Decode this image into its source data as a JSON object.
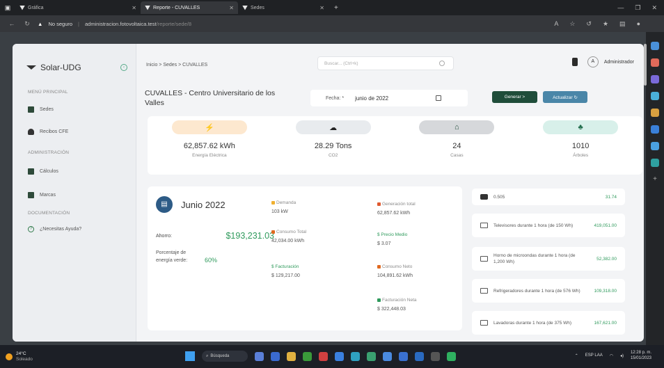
{
  "browser": {
    "tabs": [
      {
        "label": "Gráfica"
      },
      {
        "label": "Reporte - CUVALLES"
      },
      {
        "label": "Sedes"
      }
    ],
    "security": "No seguro",
    "url_host": "administracion.fotovoltaica.test",
    "url_path": "/reporte/sede/8"
  },
  "sidebar": {
    "brand": "Solar-UDG",
    "sections": [
      {
        "title": "MENÚ PRINCIPAL",
        "items": [
          "Sedes",
          "Recibos CFE"
        ]
      },
      {
        "title": "ADMINISTRACIÓN",
        "items": [
          "Cálculos",
          "Marcas"
        ]
      },
      {
        "title": "DOCUMENTACIÓN",
        "items": [
          "¿Necesitas Ayuda?"
        ]
      }
    ]
  },
  "topbar": {
    "breadcrumb": "Inicio  >  Sedes  >  CUVALLES",
    "search_placeholder": "Buscar... (Ctrl+k)",
    "avatar_letter": "A",
    "user_name": "Administrador"
  },
  "header": {
    "title": "CUVALLES - Centro Universitario de los Valles",
    "fecha_label": "Fecha: *",
    "fecha_value": "junio de 2022",
    "generar_label": "Generar  >",
    "actualizar_label": "Actualizar  ↻"
  },
  "stats": [
    {
      "icon": "lightning-icon",
      "glyph": "⚡",
      "value": "62,857.62 kWh",
      "label": "Energía Eléctrica",
      "bg": "#fde8cf",
      "color": "#f0a030"
    },
    {
      "icon": "smog-icon",
      "glyph": "☁",
      "value": "28.29 Tons",
      "label": "CO2",
      "bg": "#e8ebee",
      "color": "#222222"
    },
    {
      "icon": "house-icon",
      "glyph": "⌂",
      "value": "24",
      "label": "Casas",
      "bg": "#d6d8db",
      "color": "#1f4d3a"
    },
    {
      "icon": "tree-icon",
      "glyph": "♣",
      "value": "1010",
      "label": "Árboles",
      "bg": "#d8f0ea",
      "color": "#1f6b4a"
    }
  ],
  "report": {
    "title": "Junio 2022",
    "ahorro_label": "Ahorro:",
    "ahorro_value": "$193,231.03",
    "porcentaje_label": "Porcentaje de energía verde:",
    "porcentaje_value": "60%",
    "col1": [
      {
        "key": "Demanda",
        "value": "103 kW",
        "color": "#f0b030"
      },
      {
        "key": "Consumo Total",
        "value": "42,034.00 kWh",
        "color": "#e06a20"
      },
      {
        "key": "$ Facturación",
        "value": "$ 129,217.00",
        "color": ""
      }
    ],
    "col2": [
      {
        "key": "Generación total",
        "value": "62,857.62 kWh",
        "color": "#e05a30"
      },
      {
        "key": "$ Precio Medio",
        "value": "$ 3.07",
        "color": ""
      },
      {
        "key": "Consumo Neto",
        "value": "104,891.62 kWh",
        "color": "#e06a20"
      },
      {
        "key": "Facturación Neta",
        "value": "$ 322,448.03",
        "color": "#2f9a5c"
      }
    ]
  },
  "equivalences": [
    {
      "text": "0.505",
      "amount": "31.74"
    },
    {
      "text": "Televisores durante 1 hora (de 150 Wh)",
      "amount": "419,051.00"
    },
    {
      "text": "Horno de microondas durante 1 hora (de 1,200 Wh)",
      "amount": "52,382.00"
    },
    {
      "text": "Refrigeradores durante 1 hora (de 576 Wh)",
      "amount": "109,318.00"
    },
    {
      "text": "Lavadoras durante 1 hora (de 375 Wh)",
      "amount": "167,621.00"
    }
  ],
  "taskbar": {
    "temp": "24°C",
    "weather": "Soleado",
    "search": "Búsqueda",
    "lang": "ESP LAA",
    "time": "12:28 p. m.",
    "date": "15/01/2023"
  }
}
